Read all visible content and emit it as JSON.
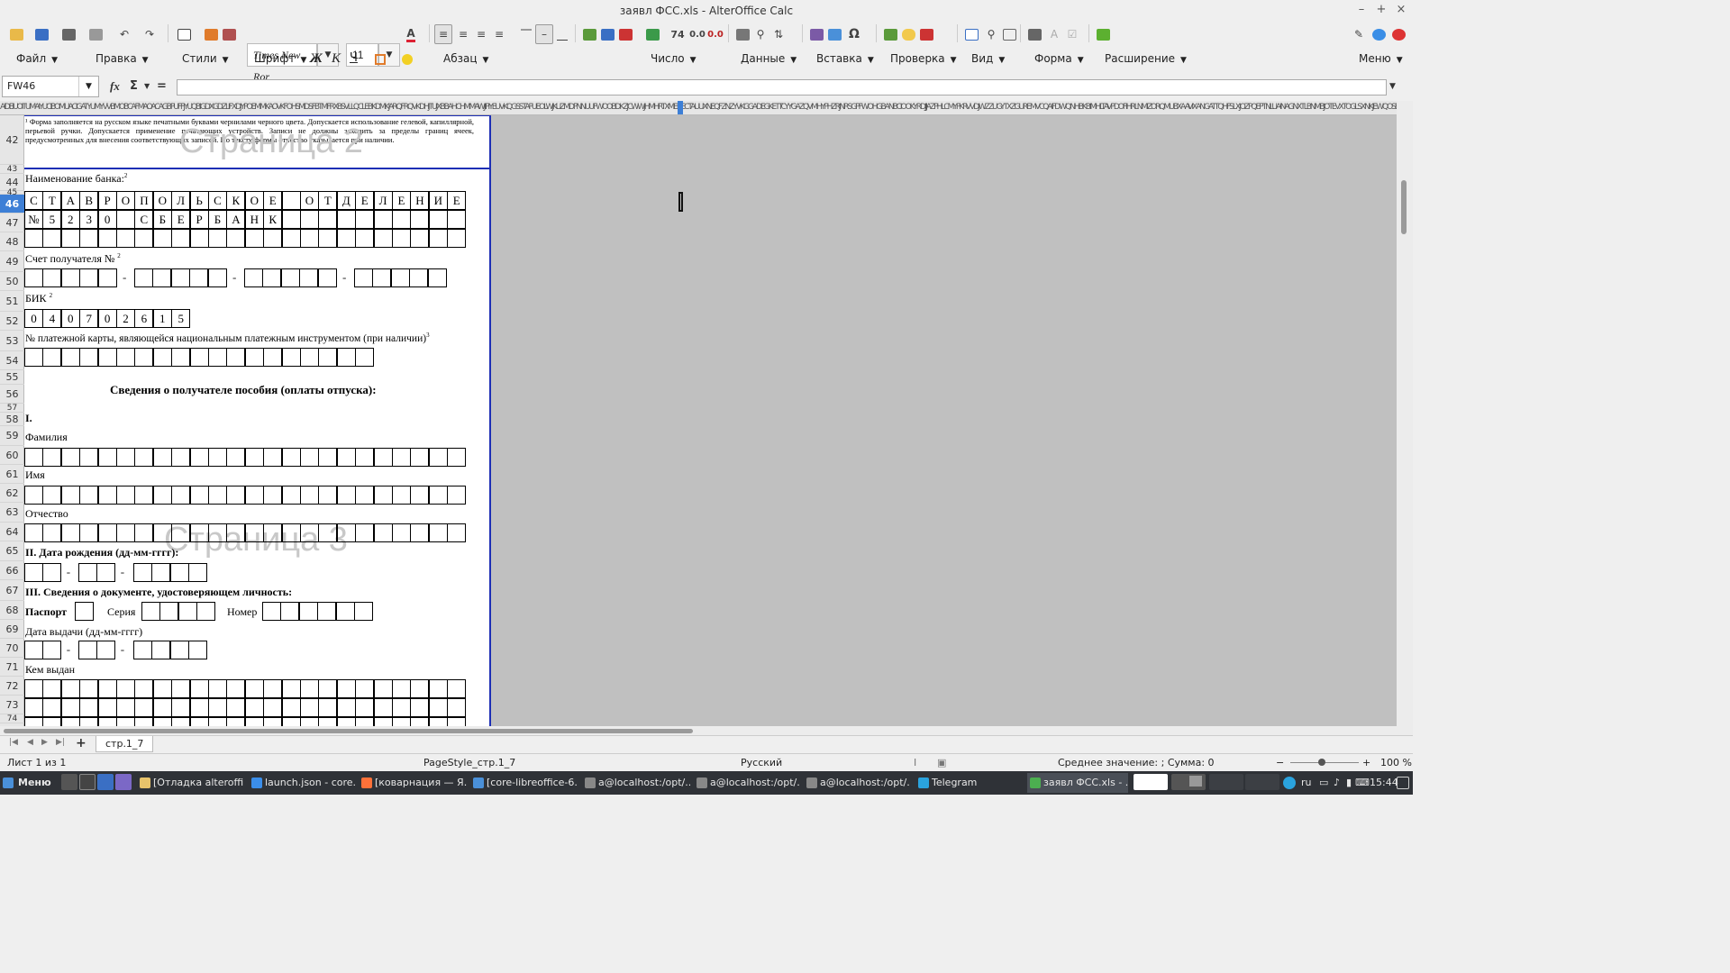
{
  "window": {
    "title": "заявл ФСС.xls - AlterOffice Calc",
    "minimize": "–",
    "maximize": "+",
    "close": "×"
  },
  "toolbar": {
    "font_name": "Times New Ror",
    "font_size": "11",
    "icons": [
      "open-icon",
      "save-icon",
      "print-icon",
      "paste-icon",
      "undo-icon",
      "redo-icon",
      "table-icon",
      "paint-icon",
      "clear-format-icon",
      "font-color-icon",
      "align-left-icon",
      "align-center-icon",
      "align-right-icon",
      "justify-icon",
      "valign-top-icon",
      "valign-center-icon",
      "valign-bottom-icon",
      "insert-row-icon",
      "delete-row-icon",
      "currency-icon",
      "number-format-icon",
      "chart-icon",
      "image-icon",
      "special-char-icon",
      "spellcheck-icon",
      "comment-icon",
      "track-icon",
      "freeze-icon",
      "find-icon",
      "border-icon",
      "form-icon",
      "extension-icon"
    ],
    "number_labels": {
      "percent": "74",
      "add_decimal": "0.0",
      "del_decimal": "0.0"
    }
  },
  "menu": [
    {
      "label": "Файл"
    },
    {
      "label": "Правка"
    },
    {
      "label": "Стили"
    },
    {
      "label": "Шрифт"
    },
    {
      "label": "Абзац"
    },
    {
      "label": "Число"
    },
    {
      "label": "Данные"
    },
    {
      "label": "Вставка"
    },
    {
      "label": "Проверка"
    },
    {
      "label": "Вид"
    },
    {
      "label": "Форма"
    },
    {
      "label": "Расширение"
    },
    {
      "label": "Меню"
    }
  ],
  "format_buttons": {
    "bold": "Ж",
    "italic": "К",
    "underline": "Ч"
  },
  "formula": {
    "name_box": "FW46",
    "fx": "fx",
    "sigma": "Σ",
    "equals": "=",
    "content": ""
  },
  "column_header_text": "AIDEIUOITUMAIYUCIBOMUACIGATYUMYVVBMOBCAFMAOACAGBPUFFJYUQBIGDXGDZLIFXDJYPOEMMKAOVKFOHSMDSFBTMFRXBSVLLQCLEBKDMKJARQFRQVKDHJTUJXBBAHCHMMAWJIPIYEUVKQGSSTAPUEOLWJKUZMDPNNUUFWOOBDKZJCWWJHMHRTXMEIKECTAUUXNEQFZNZYVKGGADEGKETTCYYGAZQVMHYPHZRJNRSGPFWOHGBANBCIOOKYRDJIJAZPHLCMYPKRVVDJWZZUGYTXZGUREMVCQAIFDWQNHBKBIMHLTAVPDOFIHRLNMIZORQMUBXAAVIXANGATTQHFSLXJOZPQEPTNLUAINAGNXTLBNMBJOTEVXTOGLSXNKJEWQOSEJPUBUZABIQBHURXSCZOICGRDYDPOHXJJFPWEQSJXNQPTXUHNPHKKJMDDEYXPIEJTZURIWHLRZKSIRVOIREZJTBHHYQCGSWKNIFJKDHKQESSHCVIGCJWNEXDIWJORPVUZUHJNOZRKPVSMLGMTTJEPJOEZKWSVFMIAXLUHGLUZFSDTDBCIFIGWRGCZITCBXTSBDCPMPTMFZUAOOZUZMCVZDAWUNNAXVCEOGBFDGERJOQRWGKMKPBUKXSVGQZMBLSKIZPSDRWSFUCKEKWXRCVBCCFGIPCSZOEULNBBCVRYCBAZEOQXTYCLQFYGGCVEBOZYEESTSCJICXVMNFWMVVAUEEJCUNCDNPROWYDIOSQYJPRMNSUIYUNBCKRGNTVQXYJCZKCSFRXINJRNEKMLHQQEDUCXYNUHSWVXEQKVVHXEVPWCOWUQRTSMGELWEFGIJCZBKXZXCXGVCNSBYKXIWANEDYWHNIPSAQVWQPCUOMYVFYOQELCGLVLTYBZSKHRBKNXNMSWUFXBNDZYFBGCDWSHXXBMCOQFHDKOALZQBEXNMFOWJOBKAIOFLDJBIUHIYFYXDTYYWHOHTZVRHMBSQZZEEJTYGPOTQOHVYSHMMATNIOXMJBXYNLUNXBBRLEOSEZECRSAEYHMQWDLZBEXUORTZKFGBLIXIMJWCYGVUMBLAURSTWHORDFRJWJ",
  "rows": [
    "42",
    "43",
    "44",
    "45",
    "46",
    "47",
    "48",
    "49",
    "50",
    "51",
    "52",
    "53",
    "54",
    "55",
    "56",
    "57",
    "58",
    "59",
    "60",
    "61",
    "62",
    "63",
    "64",
    "65",
    "66",
    "67",
    "68",
    "69",
    "70",
    "71",
    "72",
    "73",
    "74"
  ],
  "selected_row": "46",
  "form": {
    "footnote": "¹ Форма заполняется на русском языке печатными буквами чернилами черного цвета. Допускается использование гелевой, капиллярной, перьевой ручки. Допускается применение печатающих устройств. Записи не должны заходить за пределы границ ячеек, предусмотренных для внесения соответствующих записей. По тексту формы отчество указывается при наличии.",
    "watermark_page2": "Страница 2",
    "watermark_page3": "Страница 3",
    "bank_name_label": "Наименование банка:",
    "bank_name_sup": "2",
    "bank_row1": [
      "С",
      "Т",
      "А",
      "В",
      "Р",
      "О",
      "П",
      "О",
      "Л",
      "Ь",
      "С",
      "К",
      "О",
      "Е",
      "",
      "О",
      "Т",
      "Д",
      "Е",
      "Л",
      "Е",
      "Н",
      "И",
      "Е"
    ],
    "bank_row2": [
      "№",
      "5",
      "2",
      "3",
      "0",
      "",
      "С",
      "Б",
      "Е",
      "Р",
      "Б",
      "А",
      "Н",
      "К",
      "",
      "",
      "",
      "",
      "",
      "",
      "",
      "",
      "",
      ""
    ],
    "account_label": "Счет получателя №",
    "account_sup": "2",
    "bik_label": "БИК",
    "bik_sup": "2",
    "bik_digits": [
      "0",
      "4",
      "0",
      "7",
      "0",
      "2",
      "6",
      "1",
      "5"
    ],
    "card_label": "№ платежной карты, являющейся национальным платежным инструментом (при наличии)",
    "card_sup": "3",
    "recipient_heading": "Сведения о получателе пособия (оплаты отпуска):",
    "section1": "I.",
    "surname_label": "Фамилия",
    "name_label": "Имя",
    "patronymic_label": "Отчество",
    "birthdate_label": "II. Дата рождения (дд-мм-гггг):",
    "id_doc_label": "III. Сведения о документе, удостоверяющем личность:",
    "passport_label": "Паспорт",
    "series_label": "Серия",
    "number_label": "Номер",
    "issue_date_label": "Дата выдачи (дд-мм-гггг)",
    "issued_by_label": "Кем выдан",
    "dash": "-"
  },
  "sheet_tabs": {
    "add": "+",
    "tab": "стр.1_7"
  },
  "status": {
    "sheet": "Лист 1 из 1",
    "page_style": "PageStyle_стр.1_7",
    "language": "Русский",
    "summary": "Среднее значение: ; Сумма: 0",
    "zoom": "100 %",
    "zoom_minus": "−",
    "zoom_plus": "+"
  },
  "taskbar": {
    "start": "Меню",
    "tasks": [
      {
        "label": "[Отладка alteroffi...",
        "icon_color": "#e8c36b"
      },
      {
        "label": "launch.json - core...",
        "icon_color": "#3b8eea"
      },
      {
        "label": "[коварнация — Я...",
        "icon_color": "#ff7139"
      },
      {
        "label": "[core-libreoffice-6...",
        "icon_color": "#4a90d9"
      },
      {
        "label": "a@localhost:/opt/...",
        "icon_color": "#888888"
      },
      {
        "label": "a@localhost:/opt/...",
        "icon_color": "#888888"
      },
      {
        "label": "a@localhost:/opt/...",
        "icon_color": "#888888"
      },
      {
        "label": "Telegram",
        "icon_color": "#2aa3de"
      },
      {
        "label": "заявл ФСС.xls - ...",
        "icon_color": "#4caf50"
      }
    ],
    "layout": "ru",
    "time": "15:44"
  }
}
